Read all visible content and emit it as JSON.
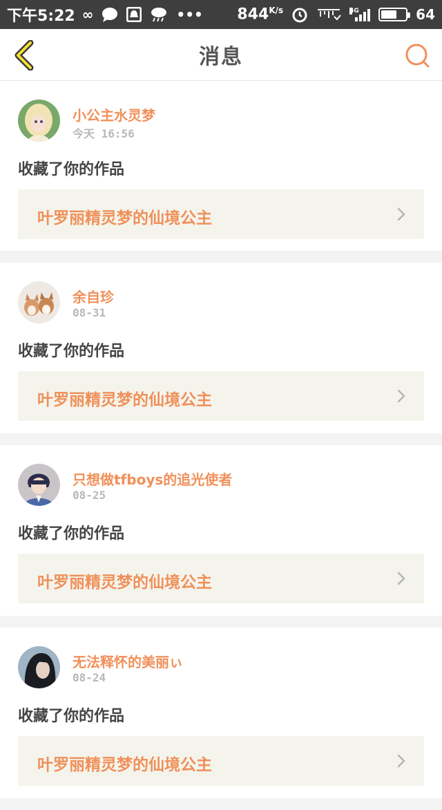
{
  "status_bar": {
    "time": "下午5:22",
    "speed": "844",
    "speed_unit": "K/s",
    "network": "4G",
    "battery": "64",
    "battery_level": 0.64
  },
  "header": {
    "title": "消息",
    "accent": "#f0905a"
  },
  "notifications": [
    {
      "user": "小公主水灵梦",
      "time": "今天 16:56",
      "action": "收藏了你的作品",
      "work": "叶罗丽精灵梦的仙境公主",
      "avatar_icon": "doll-avatar-icon"
    },
    {
      "user": "余自珍",
      "time": "08-31",
      "action": "收藏了你的作品",
      "work": "叶罗丽精灵梦的仙境公主",
      "avatar_icon": "puppies-avatar-icon"
    },
    {
      "user": "只想做tfboys的追光使者",
      "time": "08-25",
      "action": "收藏了你的作品",
      "work": "叶罗丽精灵梦的仙境公主",
      "avatar_icon": "anime-boy-avatar-icon"
    },
    {
      "user": "无法释怀的美丽ぃ",
      "time": "08-24",
      "action": "收藏了你的作品",
      "work": "叶罗丽精灵梦的仙境公主",
      "avatar_icon": "girl-photo-avatar-icon"
    }
  ]
}
